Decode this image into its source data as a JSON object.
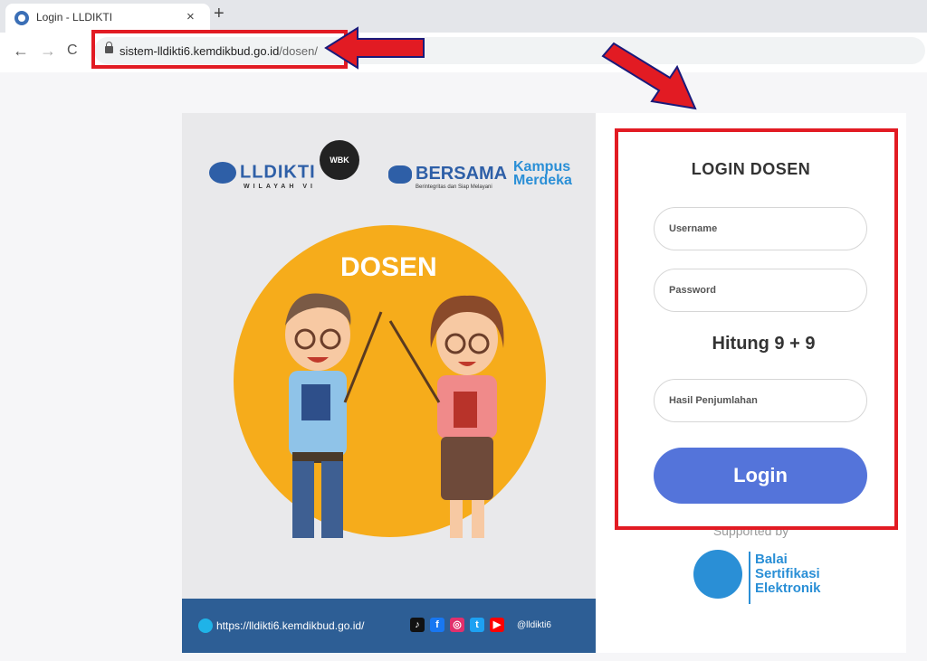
{
  "browser": {
    "tab_title": "Login - LLDIKTI",
    "tab_close": "×",
    "new_tab": "+",
    "back": "←",
    "forward": "→",
    "reload": "C",
    "url_domain": "sistem-lldikti6.kemdikbud.go.id",
    "url_path": "/dosen/"
  },
  "banner": {
    "logo_lldikti": "LLDIKTI",
    "logo_lldikti_sub": "WILAYAH VI",
    "logo_wbk": "WBK",
    "logo_bersama": "BERSAMA",
    "logo_bersama_sub": "Berintegritas dan Siap Melayani",
    "logo_kampus": "Kampus",
    "logo_merdeka": "Merdeka",
    "heading": "DOSEN",
    "website": "https://lldikti6.kemdikbud.go.id/",
    "social_handle": "@lldikti6"
  },
  "login": {
    "title": "LOGIN DOSEN",
    "username_placeholder": "Username",
    "password_placeholder": "Password",
    "captcha_question": "Hitung 9 + 9",
    "answer_placeholder": "Hasil Penjumlahan",
    "submit_label": "Login",
    "supported_by": "Supported by",
    "bse_line1": "Balai",
    "bse_line2": "Sertifikasi",
    "bse_line3": "Elektronik"
  },
  "colors": {
    "accent_button": "#5474da",
    "annotation_red": "#e21b23",
    "banner_yellow": "#f6ac1b",
    "footer_blue": "#2d5e95"
  }
}
